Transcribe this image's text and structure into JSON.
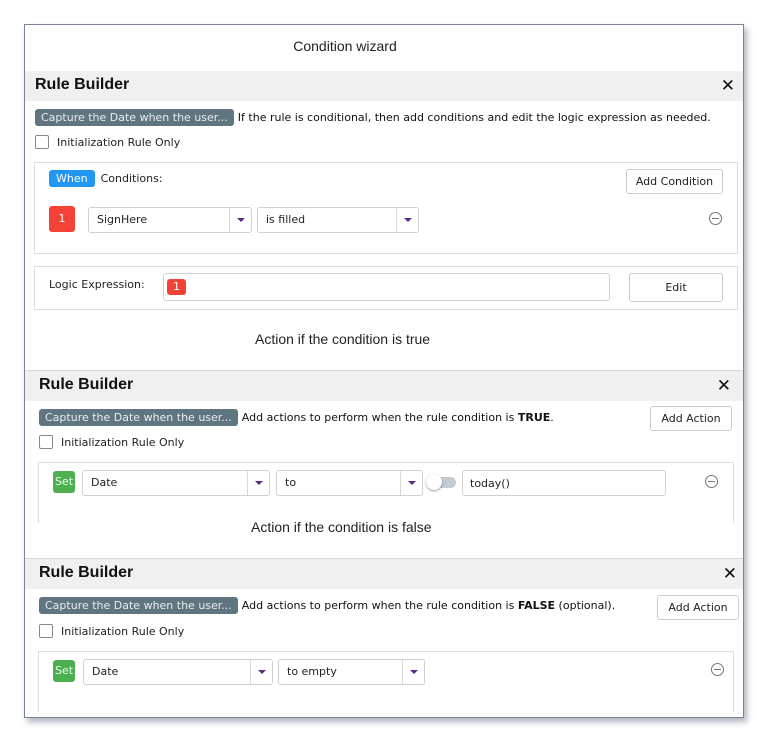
{
  "wizard": {
    "title": "Condition wizard"
  },
  "condition_builder": {
    "title": "Rule Builder",
    "rule_name": "Capture the Date when the user...",
    "description": "If the rule is conditional, then add conditions and edit the logic expression as needed.",
    "init_only_label": "Initialization Rule Only",
    "init_only_checked": false,
    "when_label": "When",
    "conditions_label": "Conditions:",
    "add_condition_label": "Add Condition",
    "conditions": [
      {
        "index": "1",
        "field": "SignHere",
        "operator": "is filled"
      }
    ],
    "logic_expression_label": "Logic Expression:",
    "logic_expression_tokens": [
      "1"
    ],
    "edit_label": "Edit"
  },
  "true_caption": "Action if the condition is true",
  "true_builder": {
    "title": "Rule Builder",
    "rule_name": "Capture the Date when the user...",
    "description_prefix": "Add actions to perform when the rule condition is ",
    "description_emphasis": "TRUE",
    "description_suffix": ".",
    "init_only_label": "Initialization Rule Only",
    "init_only_checked": false,
    "add_action_label": "Add Action",
    "actions": [
      {
        "verb": "Set",
        "field": "Date",
        "operator": "to",
        "expression_toggle": false,
        "value": "today()"
      }
    ]
  },
  "false_caption": "Action if the condition is false",
  "false_builder": {
    "title": "Rule Builder",
    "rule_name": "Capture the Date when the user...",
    "description_prefix": "Add actions to perform when the rule condition is ",
    "description_emphasis": "FALSE",
    "description_suffix": " (optional).",
    "init_only_label": "Initialization Rule Only",
    "init_only_checked": false,
    "add_action_label": "Add Action",
    "actions": [
      {
        "verb": "Set",
        "field": "Date",
        "operator": "to empty"
      }
    ]
  },
  "icons": {
    "close": "close-x-icon",
    "remove": "minus-circle-icon",
    "dropdown": "triangle-down-icon"
  },
  "colors": {
    "when_badge": "#2196f3",
    "index_badge": "#f44336",
    "set_badge": "#4caf50",
    "rule_pill": "#5f7580",
    "dropdown_arrow": "#5b2a86"
  }
}
